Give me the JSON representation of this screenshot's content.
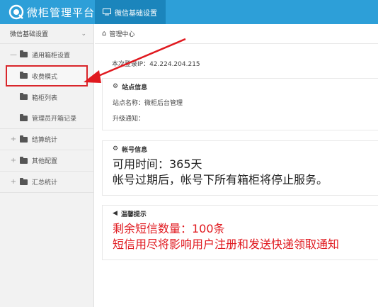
{
  "app": {
    "title": "微柜管理平台"
  },
  "topnav": {
    "tab_label": "微信基础设置"
  },
  "sidebar": {
    "header": "微信基础设置",
    "items": [
      {
        "label": "通用箱柜设置",
        "toggle": "—"
      },
      {
        "label": "收费模式"
      },
      {
        "label": "箱柜列表"
      },
      {
        "label": "管理员开箱记录"
      },
      {
        "label": "结算统计",
        "toggle": "+"
      },
      {
        "label": "其他配置",
        "toggle": "+"
      },
      {
        "label": "汇总统计",
        "toggle": "+"
      }
    ]
  },
  "breadcrumb": {
    "label": "管理中心"
  },
  "login": {
    "text": "本次登录IP：42.224.204.215"
  },
  "site_info": {
    "title": "站点信息",
    "site_name": "站点名称：微柜后台管理",
    "upgrade": "升级通知："
  },
  "account_info": {
    "title": "帐号信息",
    "available": "可用时间：365天",
    "expire_note": "帐号过期后，帐号下所有箱柜将停止服务。"
  },
  "tips": {
    "title": "温馨提示",
    "sms_remaining": "剩余短信数量：100条",
    "sms_warning": "短信用尽将影响用户注册和发送快递领取通知"
  },
  "colors": {
    "topbar": "#2d9fd8",
    "active_tab": "#1b85bc",
    "highlight_red": "#d9262b",
    "warning_text": "#e0191f"
  }
}
